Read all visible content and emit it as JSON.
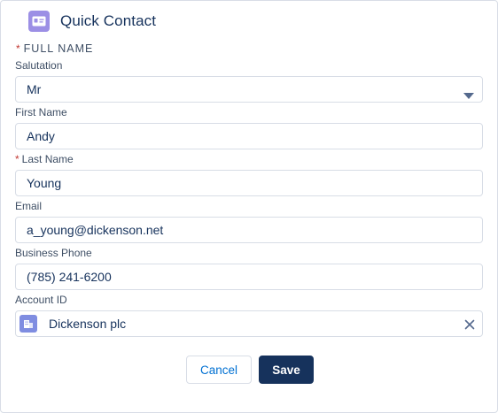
{
  "header": {
    "title": "Quick Contact",
    "icon": "contact-card-icon",
    "icon_color": "#9c8fe5"
  },
  "section": {
    "title": "FULL NAME",
    "required_mark": "*"
  },
  "fields": {
    "salutation": {
      "label": "Salutation",
      "value": "Mr"
    },
    "first_name": {
      "label": "First Name",
      "value": "Andy"
    },
    "last_name": {
      "label": "Last Name",
      "value": "Young",
      "required_mark": "*"
    },
    "email": {
      "label": "Email",
      "value": "a_young@dickenson.net"
    },
    "phone": {
      "label": "Business Phone",
      "value": "(785) 241-6200"
    },
    "account": {
      "label": "Account ID",
      "value": "Dickenson plc",
      "icon": "account-building-icon",
      "icon_color": "#7f8de1"
    }
  },
  "buttons": {
    "cancel": "Cancel",
    "save": "Save"
  },
  "colors": {
    "required": "#c23934",
    "brand_dark": "#16325c",
    "link": "#0070d2"
  }
}
